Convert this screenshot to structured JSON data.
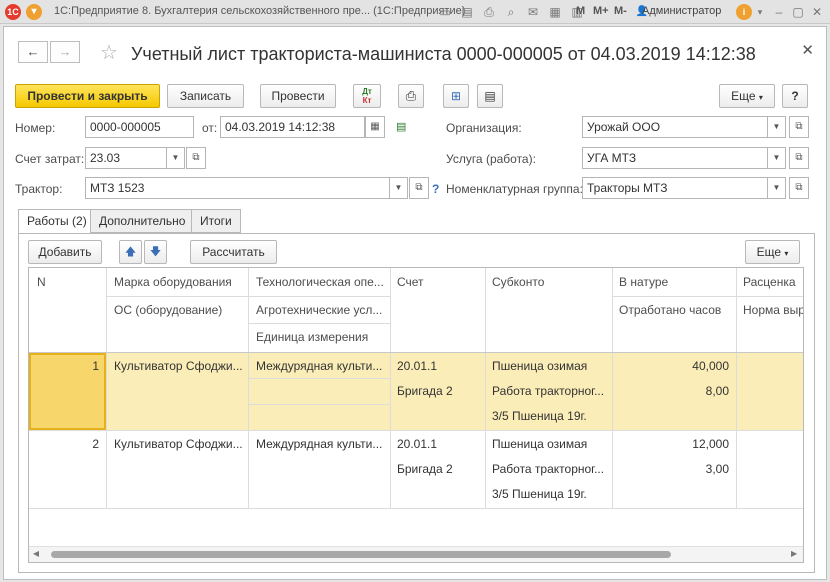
{
  "titlebar": {
    "title": "1С:Предприятие 8. Бухгалтерия сельскохозяйственного пре... (1С:Предприятие)",
    "m_labels": [
      "M",
      "M+",
      "M-"
    ],
    "user": "Администратор"
  },
  "document": {
    "title": "Учетный лист тракториста-машиниста 0000-000005 от 04.03.2019 14:12:38"
  },
  "toolbar": {
    "post_close": "Провести и закрыть",
    "save": "Записать",
    "post": "Провести",
    "dtkt_dt": "Дт",
    "dtkt_kt": "Кт",
    "more": "Еще",
    "help": "?"
  },
  "fields": {
    "number_label": "Номер:",
    "number_value": "0000-000005",
    "date_label": "от:",
    "date_value": "04.03.2019 14:12:38",
    "cost_account_label": "Счет затрат:",
    "cost_account_value": "23.03",
    "tractor_label": "Трактор:",
    "tractor_value": "МТЗ 1523",
    "org_label": "Организация:",
    "org_value": "Урожай ООО",
    "service_label": "Услуга (работа):",
    "service_value": "УГА МТЗ",
    "nomgroup_label": "Номенклатурная группа:",
    "nomgroup_value": "Тракторы МТЗ",
    "help_mark": "?"
  },
  "tabs": [
    {
      "label": "Работы (2)"
    },
    {
      "label": "Дополнительно"
    },
    {
      "label": "Итоги"
    }
  ],
  "table_toolbar": {
    "add": "Добавить",
    "calculate": "Рассчитать",
    "more": "Еще"
  },
  "table": {
    "headers": {
      "n": "N",
      "equipment_brand": "Марка оборудования",
      "fixed_asset": "ОС (оборудование)",
      "tech_operation": "Технологическая опе...",
      "agro_conditions": "Агротехнические усл...",
      "unit": "Единица измерения",
      "account": "Счет",
      "subconto": "Субконто",
      "in_kind": "В натуре",
      "hours_worked": "Отработано часов",
      "rate": "Расценка",
      "norm": "Норма выр"
    },
    "rows": [
      {
        "n": "1",
        "equipment": "Культиватор Сфоджи...",
        "operation": "Междурядная культи...",
        "account": "20.01.1",
        "account2": "Бригада 2",
        "subconto1": "Пшеница озимая",
        "subconto2": "Работа тракторног...",
        "subconto3": "3/5 Пшеница 19г.",
        "in_kind": "40,000",
        "hours": "8,00"
      },
      {
        "n": "2",
        "equipment": "Культиватор Сфоджи...",
        "operation": "Междурядная культи...",
        "account": "20.01.1",
        "account2": "Бригада 2",
        "subconto1": "Пшеница озимая",
        "subconto2": "Работа тракторног...",
        "subconto3": "3/5 Пшеница 19г.",
        "in_kind": "12,000",
        "hours": "3,00"
      }
    ]
  },
  "colors": {
    "primary_button": "#f5c900",
    "selected_row": "#fbedb8",
    "selected_cell": "#f7d76b"
  }
}
